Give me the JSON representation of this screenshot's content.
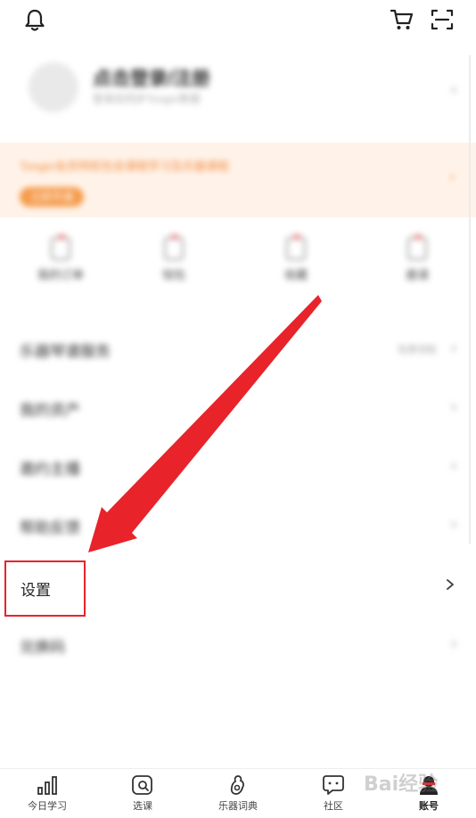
{
  "profile": {
    "name": "点击登录/注册",
    "id_text": "登录后同步Tonger数据"
  },
  "banner": {
    "text": "Tonger会员特权包含课程学习及乐器课程",
    "button": "立即开通"
  },
  "quick_actions": [
    {
      "label": "我的订单"
    },
    {
      "label": "钱包"
    },
    {
      "label": "收藏"
    },
    {
      "label": "邀请"
    }
  ],
  "menu": [
    {
      "label": "乐器琴谱服务",
      "extra": "免费领取"
    },
    {
      "label": "我的资产",
      "extra": ""
    },
    {
      "label": "邀约主播",
      "extra": ""
    },
    {
      "label": "帮助反馈",
      "extra": ""
    }
  ],
  "settings": {
    "label": "设置"
  },
  "menu_after": [
    {
      "label": "兑换码"
    }
  ],
  "tabbar": [
    {
      "label": "今日学习",
      "icon": "bar-chart-icon"
    },
    {
      "label": "选课",
      "icon": "search-course-icon"
    },
    {
      "label": "乐器词典",
      "icon": "guitar-icon"
    },
    {
      "label": "社区",
      "icon": "chat-bubble-icon"
    },
    {
      "label": "账号",
      "icon": "account-avatar-icon"
    }
  ],
  "watermark": "Bai经验",
  "colors": {
    "accent_red": "#e8232a",
    "banner_bg": "#fff3e9",
    "banner_orange": "#f59a4a"
  }
}
